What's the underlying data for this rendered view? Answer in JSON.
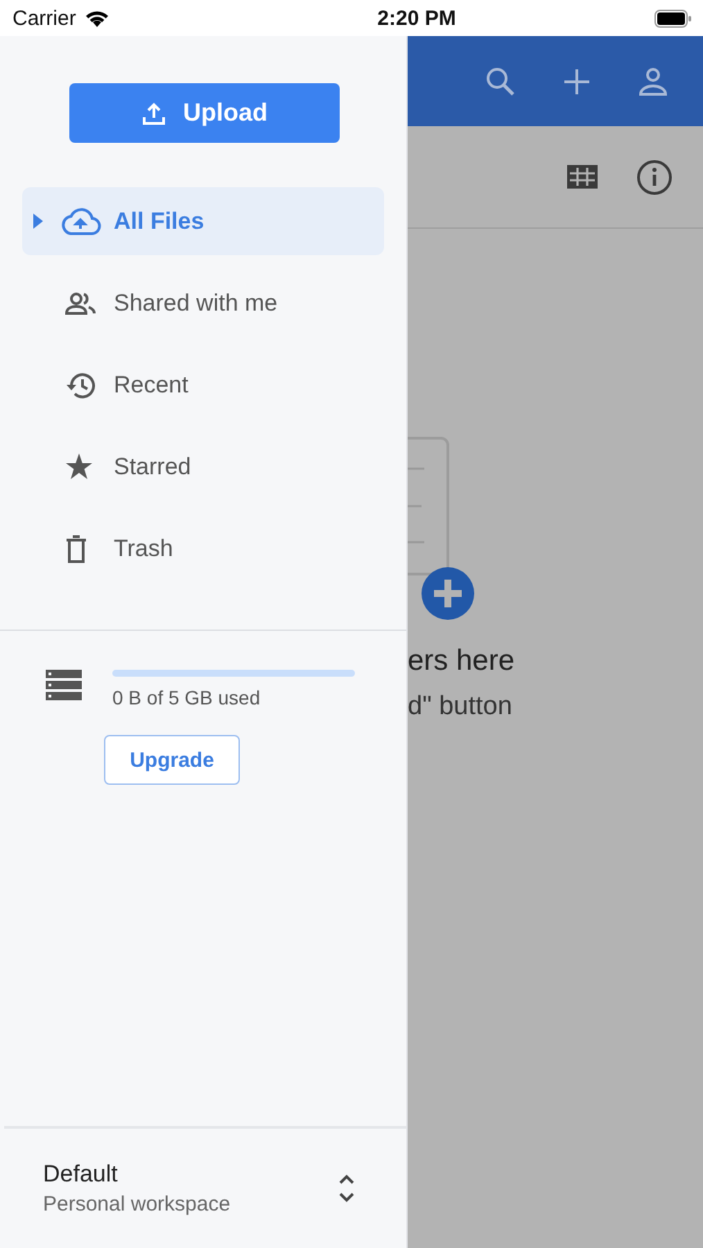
{
  "status_bar": {
    "carrier": "Carrier",
    "time": "2:20 PM"
  },
  "drawer": {
    "upload_button": "Upload",
    "nav_items": [
      {
        "kind": "cloud",
        "label": "All Files",
        "selected": true
      },
      {
        "kind": "people",
        "label": "Shared with me",
        "selected": false
      },
      {
        "kind": "history",
        "label": "Recent",
        "selected": false
      },
      {
        "kind": "star",
        "label": "Starred",
        "selected": false
      },
      {
        "kind": "trash",
        "label": "Trash",
        "selected": false
      }
    ],
    "storage": {
      "usage": "0 B of 5 GB used",
      "level": 0
    },
    "upgrade_button": "Upgrade",
    "workspace": {
      "name": "Default",
      "subtitle": "Personal workspace"
    }
  },
  "main": {
    "empty_title": "ers here",
    "empty_subtitle": "d\" button"
  }
}
